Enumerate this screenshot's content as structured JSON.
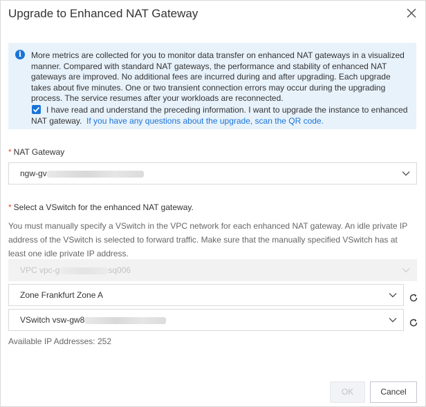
{
  "dialog": {
    "title": "Upgrade to Enhanced NAT Gateway",
    "close_icon": "close-icon"
  },
  "notice": {
    "icon": "info-icon",
    "text": "More metrics are collected for you to monitor data transfer on enhanced NAT gateways in a visualized manner. Compared with standard NAT gateways, the performance and stability of enhanced NAT gateways are improved. No additional fees are incurred during and after upgrading. Each upgrade takes about five minutes. One or two transient connection errors may occur during the upgrading process. The service resumes after your workloads are reconnected.",
    "agree_checked": true,
    "agree_text": "I have read and understand the preceding information. I want to upgrade the instance to enhanced NAT gateway.",
    "link_text": "If you have any questions about the upgrade, scan the QR code."
  },
  "nat_gateway": {
    "required_mark": "*",
    "label": "NAT Gateway",
    "value_prefix": "ngw-gv"
  },
  "vswitch_section": {
    "required_mark": "*",
    "label": "Select a VSwitch for the enhanced NAT gateway.",
    "description": "You must manually specify a VSwitch in the VPC network for each enhanced NAT gateway. An idle private IP address of the VSwitch is selected to forward traffic. Make sure that the manually specified VSwitch has at least one idle private IP address."
  },
  "vpc_select": {
    "prefix": "VPC vpc-g",
    "suffix": "sq006",
    "disabled": true
  },
  "zone_select": {
    "value": "Zone Frankfurt Zone A"
  },
  "vswitch_select": {
    "prefix": "VSwitch vsw-gw8"
  },
  "available_ip": "Available IP Addresses: 252",
  "footer": {
    "ok_label": "OK",
    "ok_disabled": true,
    "cancel_label": "Cancel"
  },
  "colors": {
    "accent": "#1a74d8",
    "required": "#e84738",
    "notice_bg": "#e8f2fb"
  }
}
